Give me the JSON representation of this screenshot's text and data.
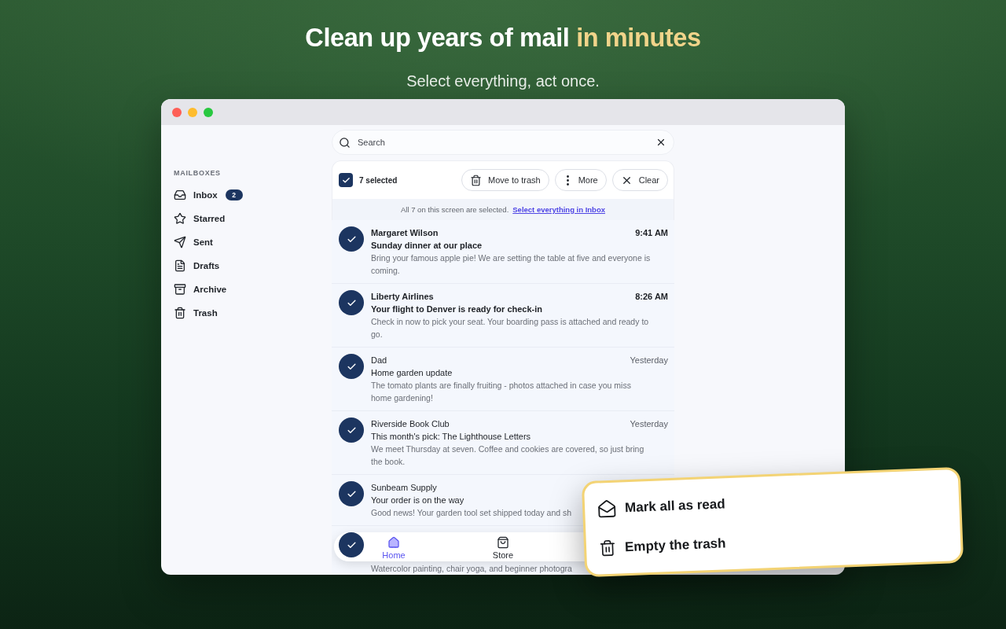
{
  "headline": {
    "text": "Clean up years of mail",
    "highlight": "in minutes"
  },
  "subtitle": "Select everything, act once.",
  "window": {
    "controls": [
      {
        "color": "#fe5f57"
      },
      {
        "color": "#febc2e"
      },
      {
        "color": "#28c840"
      }
    ],
    "sidebar": {
      "heading": "MAILBOXES",
      "items": [
        {
          "kind": "inbox",
          "label": "Inbox",
          "badge": "2"
        },
        {
          "kind": "starred",
          "label": "Starred"
        },
        {
          "kind": "sent",
          "label": "Sent"
        },
        {
          "kind": "drafts",
          "label": "Drafts"
        },
        {
          "kind": "archive",
          "label": "Archive"
        },
        {
          "kind": "trash",
          "label": "Trash"
        }
      ]
    },
    "search": {
      "placeholder": "Search"
    },
    "selection": {
      "checked": true,
      "count": "7 selected",
      "actions": [
        {
          "kind": "trash",
          "label": "Move to trash"
        },
        {
          "kind": "more",
          "label": "More"
        },
        {
          "kind": "clear",
          "label": "Clear"
        }
      ],
      "notice": "All 7 on this screen are selected.",
      "link": "Select everything in Inbox"
    },
    "messages": [
      {
        "sender": "Margaret Wilson",
        "time": "9:41 AM",
        "subject": "Sunday dinner at our place",
        "preview": "Bring your famous apple pie! We are setting the table at five and everyone is coming.",
        "unread": true,
        "selected": true
      },
      {
        "sender": "Liberty Airlines",
        "time": "8:26 AM",
        "subject": "Your flight to Denver is ready for check-in",
        "preview": "Check in now to pick your seat. Your boarding pass is attached and ready to go.",
        "unread": true,
        "selected": true
      },
      {
        "sender": "Dad",
        "time": "Yesterday",
        "subject": "Home garden update",
        "preview": "The tomato plants are finally fruiting - photos attached in case you miss home gardening!",
        "unread": false,
        "selected": true
      },
      {
        "sender": "Riverside Book Club",
        "time": "Yesterday",
        "subject": "This month's pick: The Lighthouse Letters",
        "preview": "We meet Thursday at seven. Coffee and cookies are covered, so just bring the book.",
        "unread": false,
        "selected": true
      },
      {
        "sender": "Sunbeam Supply",
        "subject": "Your order is on the way",
        "preview": "Good news! Your garden tool set shipped today and sh",
        "unread": false,
        "selected": true
      },
      {
        "preview": "Watercolor painting, chair yoga, and beginner photogra",
        "selected": true
      }
    ],
    "bottom_nav": [
      {
        "kind": "home",
        "label": "Home",
        "selected": true
      },
      {
        "kind": "store",
        "label": "Store",
        "selected": false
      }
    ]
  },
  "popup_menu": {
    "items": [
      {
        "kind": "mark_read",
        "label": "Mark all as read"
      },
      {
        "kind": "empty_trash",
        "label": "Empty the trash"
      }
    ]
  }
}
